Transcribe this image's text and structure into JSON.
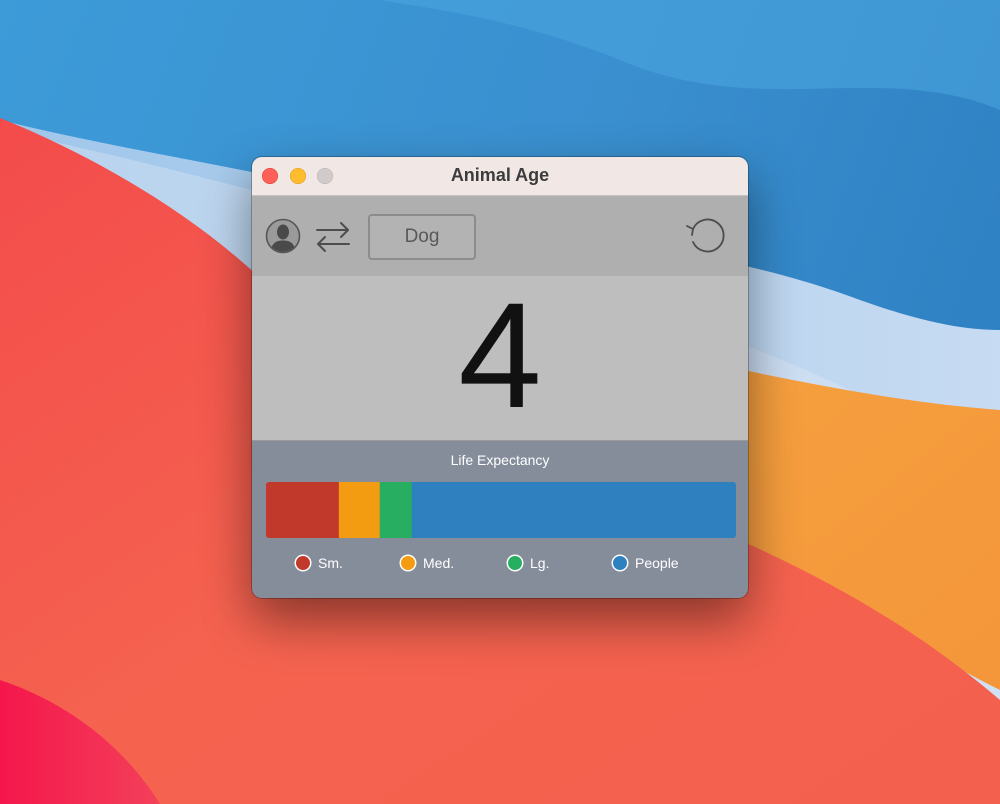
{
  "window": {
    "title": "Animal Age"
  },
  "toolbar": {
    "profile_icon": "person-silhouette-icon",
    "swap_icon": "swap-arrows-icon",
    "animal_label": "Dog",
    "reset_icon": "counterclockwise-reset-icon"
  },
  "age": {
    "value": "4"
  },
  "life_expectancy": {
    "title": "Life Expectancy",
    "segments": [
      {
        "name": "Sm.",
        "share": 0.155,
        "color": "#c0392b"
      },
      {
        "name": "Med.",
        "share": 0.087,
        "color": "#f39c12"
      },
      {
        "name": "Lg.",
        "share": 0.068,
        "color": "#27ae60"
      },
      {
        "name": "People",
        "share": 0.69,
        "color": "#2e80bf"
      }
    ]
  },
  "legend": [
    {
      "label": "Sm.",
      "color": "#c0392b"
    },
    {
      "label": "Med.",
      "color": "#f39c12"
    },
    {
      "label": "Lg.",
      "color": "#27ae60"
    },
    {
      "label": "People",
      "color": "#2e80bf"
    }
  ]
}
